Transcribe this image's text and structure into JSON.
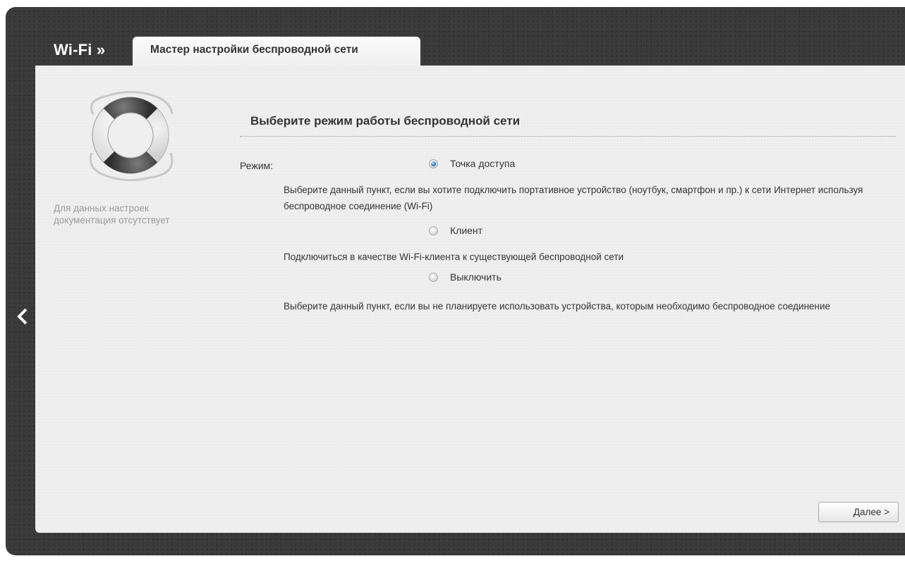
{
  "header": {
    "root_label": "Wi-Fi »",
    "active_tab": "Мастер настройки беспроводной сети"
  },
  "help": {
    "icon": "lifebuoy-icon",
    "text": "Для данных настроек документация отсутствует"
  },
  "navigation": {
    "back_icon": "chevron-left-icon"
  },
  "section": {
    "title": "Выберите режим работы беспроводной сети",
    "mode_label": "Режим:",
    "options": [
      {
        "label": "Точка доступа",
        "checked": true,
        "description": "Выберите данный пункт, если вы хотите подключить портативное устройство (ноутбук, смартфон и пр.) к сети Интернет используя беспроводное соединение (Wi-Fi)"
      },
      {
        "label": "Клиент",
        "checked": false,
        "description": "Подключиться в качестве Wi-Fi-клиента к существующей беспроводной сети"
      },
      {
        "label": "Выключить",
        "checked": false,
        "description": "Выберите данный пункт, если вы не планируете использовать устройства, которым необходимо беспроводное соединение"
      }
    ]
  },
  "footer": {
    "next_label": "Далее >"
  },
  "colors": {
    "frame": "#3a3a3a",
    "panel": "#efefef",
    "radio_selected": "#1f6fd3"
  }
}
